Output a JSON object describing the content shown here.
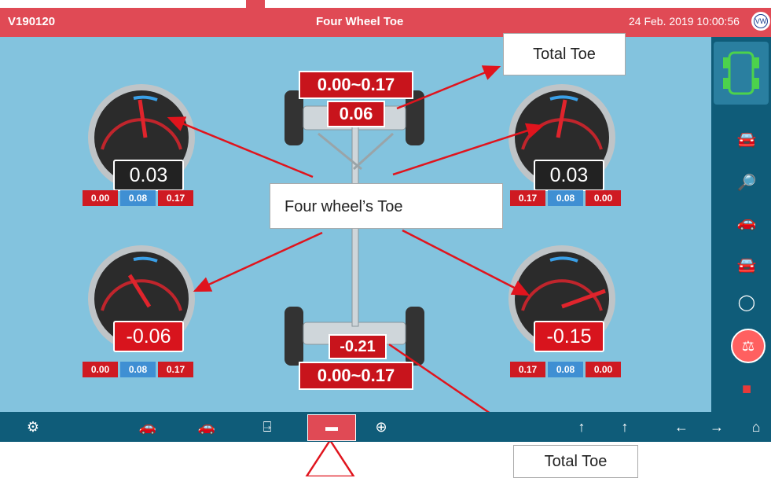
{
  "header": {
    "version": "V190120",
    "title": "Four Wheel Toe",
    "datetime": "24 Feb. 2019 10:00:56",
    "brand_logo": "VW"
  },
  "gauges": {
    "front_left": {
      "value": "0.03",
      "min": "0.00",
      "target": "0.08",
      "max": "0.17"
    },
    "front_right": {
      "value": "0.03",
      "min": "0.17",
      "target": "0.08",
      "max": "0.00"
    },
    "rear_left": {
      "value": "-0.06",
      "min": "0.00",
      "target": "0.08",
      "max": "0.17"
    },
    "rear_right": {
      "value": "-0.15",
      "min": "0.17",
      "target": "0.08",
      "max": "0.00"
    }
  },
  "total_toe": {
    "front_range": "0.00~0.17",
    "front_value": "0.06",
    "rear_value": "-0.21",
    "rear_range": "0.00~0.17"
  },
  "callouts": {
    "total_toe_top": "Total Toe",
    "four_wheel": "Four wheel’s Toe",
    "total_toe_bottom": "Total Toe"
  },
  "icons": {
    "right": [
      "car-top-view-icon",
      "car-red-icon",
      "car-search-icon",
      "car-service-icon",
      "car-front-icon",
      "wheel-gauge-icon",
      "steering-level-icon",
      "car-small-icon"
    ],
    "bottom": [
      "gear-icon",
      "car-side-icon",
      "car-side2-icon",
      "axle-icon",
      "toe-icon",
      "steering-wheel-icon",
      "camber-front-icon",
      "camber-rear-icon",
      "arrow-left-icon",
      "arrow-right-icon",
      "home-icon"
    ]
  },
  "colors": {
    "accent_red": "#e04a55",
    "panel_blue": "#83c3de",
    "toolbar_dark": "#0f5c79"
  }
}
